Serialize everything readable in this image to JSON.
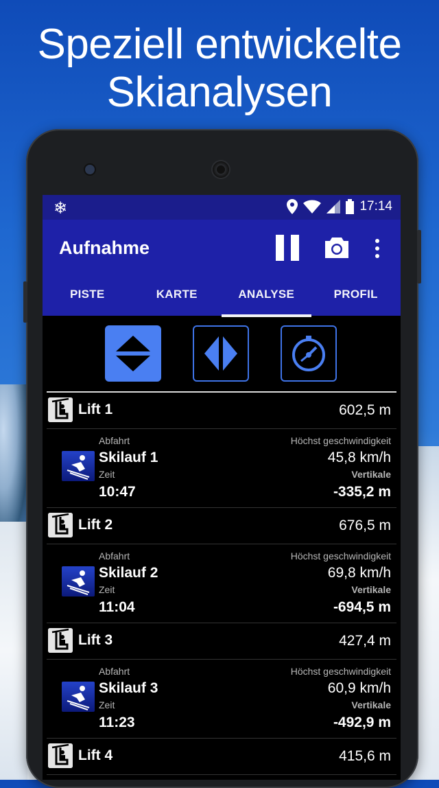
{
  "headline": {
    "line1": "Speziell entwickelte",
    "line2": "Skianalysen"
  },
  "status": {
    "time": "17:14"
  },
  "appbar": {
    "title": "Aufnahme"
  },
  "tabs": [
    {
      "label": "PISTE",
      "active": false
    },
    {
      "label": "KARTE",
      "active": false
    },
    {
      "label": "ANALYSE",
      "active": true
    },
    {
      "label": "PROFIL",
      "active": false
    }
  ],
  "labels": {
    "descent": "Abfahrt",
    "top_speed": "Höchst geschwindigkeit",
    "time": "Zeit",
    "vertical": "Vertikale"
  },
  "lifts": [
    {
      "name": "Lift 1",
      "value": "602,5 m"
    },
    {
      "name": "Lift 2",
      "value": "676,5 m"
    },
    {
      "name": "Lift 3",
      "value": "427,4 m"
    },
    {
      "name": "Lift 4",
      "value": "415,6 m"
    }
  ],
  "runs": [
    {
      "name": "Skilauf 1",
      "time": "10:47",
      "speed": "45,8 km/h",
      "vertical": "-335,2 m"
    },
    {
      "name": "Skilauf 2",
      "time": "11:04",
      "speed": "69,8 km/h",
      "vertical": "-694,5 m"
    },
    {
      "name": "Skilauf 3",
      "time": "11:23",
      "speed": "60,9 km/h",
      "vertical": "-492,9 m"
    }
  ],
  "colors": {
    "appbar": "#1e21a8",
    "statusbar": "#1b1d8c",
    "filter_active": "#4a7ff2"
  }
}
